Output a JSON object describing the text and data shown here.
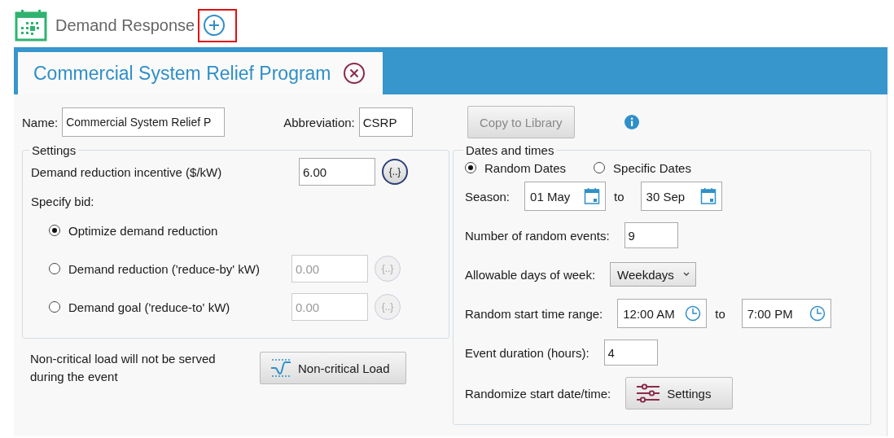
{
  "header": {
    "title": "Demand Response",
    "add_button": {
      "highlighted": true
    }
  },
  "program_tab": {
    "label": "Commercial System Relief Program"
  },
  "general": {
    "name": {
      "label": "Name:",
      "value": "Commercial System Relief P"
    },
    "abbreviation": {
      "label": "Abbreviation:",
      "value": "CSRP"
    },
    "copy_button": {
      "label": "Copy to Library",
      "disabled": true
    }
  },
  "settings": {
    "legend": "Settings",
    "incentive": {
      "label": "Demand reduction incentive ($/kW)",
      "value": "6.00",
      "expression": "{..}"
    },
    "bid_label": "Specify bid:",
    "bid_options": [
      {
        "label": "Optimize demand reduction",
        "selected": true
      },
      {
        "label": "Demand reduction ('reduce-by' kW)",
        "selected": false,
        "value": "0.00",
        "expression": "{..}",
        "disabled": true
      },
      {
        "label": "Demand goal ('reduce-to' kW)",
        "selected": false,
        "value": "0.00",
        "expression": "{..}",
        "disabled": true
      }
    ]
  },
  "load_note": "Non-critical load will not be served during the event",
  "load_button": {
    "label": "Non-critical Load"
  },
  "dates": {
    "legend": "Dates and times",
    "modes": [
      {
        "label": "Random Dates",
        "selected": true
      },
      {
        "label": "Specific Dates",
        "selected": false
      }
    ],
    "season": {
      "label": "Season:",
      "from": "01 May",
      "to_label": "to",
      "to": "30 Sep"
    },
    "events": {
      "label": "Number of random events:",
      "value": "9"
    },
    "days": {
      "label": "Allowable days of week:",
      "value": "Weekdays"
    },
    "time_range": {
      "label": "Random start time range:",
      "from": "12:00 AM",
      "to_label": "to",
      "to": "7:00 PM"
    },
    "duration": {
      "label": "Event duration (hours):",
      "value": "4"
    },
    "randomize": {
      "label": "Randomize start date/time:",
      "button": "Settings"
    }
  }
}
